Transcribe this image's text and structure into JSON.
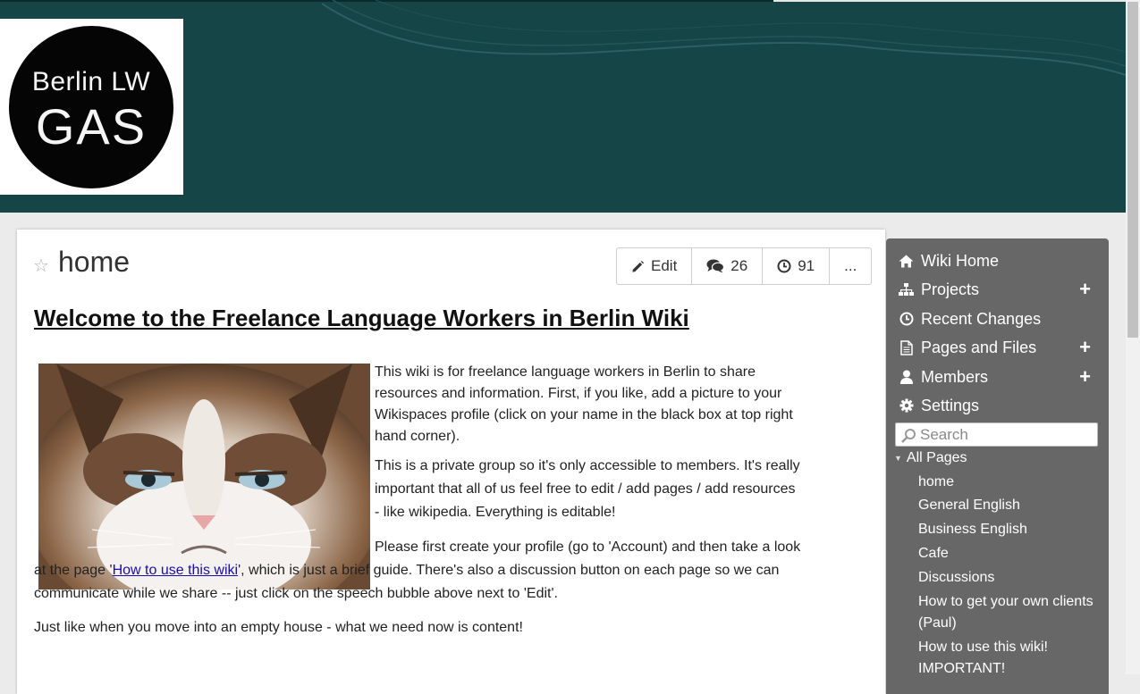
{
  "logo": {
    "line1": "Berlin LW",
    "line2": "GAS"
  },
  "page": {
    "title": "home"
  },
  "toolbar": {
    "edit_label": "Edit",
    "comments_count": "26",
    "history_count": "91",
    "more_label": "..."
  },
  "content": {
    "heading": "Welcome to the Freelance Language Workers in Berlin Wiki",
    "p1": "This wiki is for freelance language workers in Berlin to share resources and information. First, if you like, add a picture to your Wikispaces profile (click on your name in the black box at top right hand corner).",
    "p2": "This is a private group so it's only accessible to members. It's really important that all of us feel free to edit / add pages / add resources - like wikipedia. Everything is editable!",
    "p3_before": "Please first create your profile (go to 'Account) and then take a look at the page '",
    "p3_link": "How to use this wiki",
    "p3_after": "', which is just a brief guide. There's also a discussion button on each page so we can communicate while we share -- just click on the speech bubble above next to 'Edit'.",
    "p4": "Just like when you move into an empty house - what we need now is content!"
  },
  "sidebar": {
    "nav": [
      {
        "label": "Wiki Home",
        "icon": "home-icon"
      },
      {
        "label": "Projects",
        "icon": "sitemap-icon"
      },
      {
        "label": "Recent Changes",
        "icon": "clock-icon"
      },
      {
        "label": "Pages and Files",
        "icon": "file-icon"
      },
      {
        "label": "Members",
        "icon": "user-icon"
      },
      {
        "label": "Settings",
        "icon": "gear-icon"
      }
    ],
    "search_placeholder": "Search",
    "all_pages_label": "All Pages",
    "pages": [
      "home",
      "General English",
      "Business English",
      "Cafe",
      "Discussions",
      "How to get your own clients (Paul)",
      "How to use this wiki!",
      "IMPORTANT!"
    ]
  },
  "colors": {
    "header_bg": "#154547",
    "sidebar_bg": "#676767",
    "link": "#1a0dab"
  }
}
